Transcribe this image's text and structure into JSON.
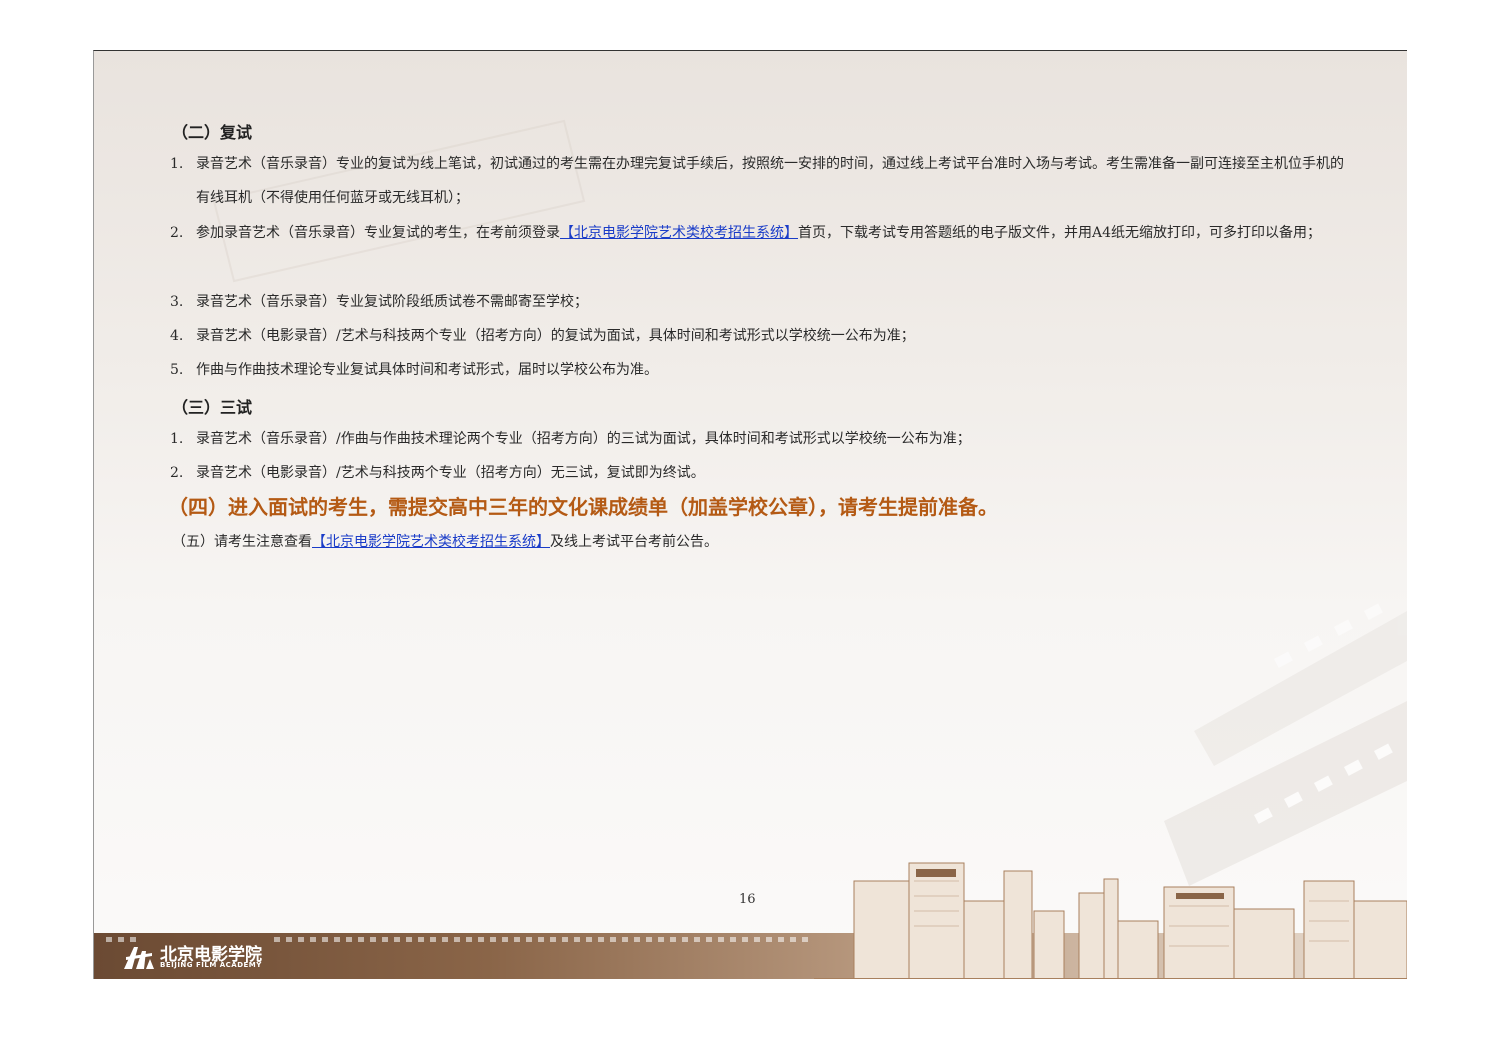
{
  "retest": {
    "heading": "（二）复试",
    "items": [
      {
        "num": "1.",
        "text": "录音艺术（音乐录音）专业的复试为线上笔试，初试通过的考生需在办理完复试手续后，按照统一安排的时间，通过线上考试平台准时入场与考试。考生需准备一副可连接至主机位手机的有线耳机（不得使用任何蓝牙或无线耳机）；"
      },
      {
        "num": "2.",
        "before": "参加录音艺术（音乐录音）专业复试的考生，在考前须登录",
        "link": "【北京电影学院艺术类校考招生系统】",
        "after": "首页，下载考试专用答题纸的电子版文件，并用A4纸无缩放打印，可多打印以备用；"
      },
      {
        "num": "3.",
        "text": "录音艺术（音乐录音）专业复试阶段纸质试卷不需邮寄至学校；"
      },
      {
        "num": "4.",
        "text": "录音艺术（电影录音）/艺术与科技两个专业（招考方向）的复试为面试，具体时间和考试形式以学校统一公布为准；"
      },
      {
        "num": "5.",
        "text": "作曲与作曲技术理论专业复试具体时间和考试形式，届时以学校公布为准。"
      }
    ]
  },
  "third_test": {
    "heading": "（三）三试",
    "items": [
      {
        "num": "1.",
        "text": "录音艺术（音乐录音）/作曲与作曲技术理论两个专业（招考方向）的三试为面试，具体时间和考试形式以学校统一公布为准；"
      },
      {
        "num": "2.",
        "text": "录音艺术（电影录音）/艺术与科技两个专业（招考方向）无三试，复试即为终试。"
      }
    ]
  },
  "notice_four": "（四）进入面试的考生，需提交高中三年的文化课成绩单（加盖学校公章），请考生提前准备。",
  "notice_five": {
    "before": "（五）请考生注意查看",
    "link": "【北京电影学院艺术类校考招生系统】",
    "after": "及线上考试平台考前公告。"
  },
  "page_number": "16",
  "footer": {
    "logo_cn": "北京电影学院",
    "logo_en": "BEIJING FILM ACADEMY"
  },
  "colors": {
    "notice": "#b45a14",
    "link": "#1a3cc8",
    "footer_brown": "#6b4a33"
  }
}
